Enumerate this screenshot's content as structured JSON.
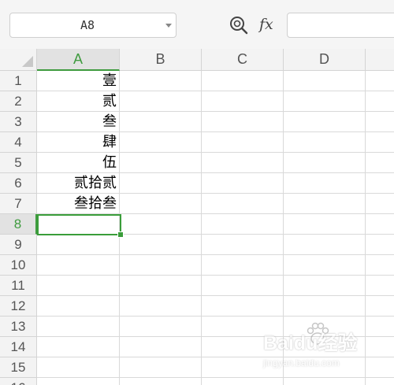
{
  "formula_bar": {
    "name_box_value": "A8",
    "zoom_icon": "zoom-lookup-icon",
    "fx_label": "fx",
    "formula_value": ""
  },
  "columns": [
    "A",
    "B",
    "C",
    "D"
  ],
  "active_column": "A",
  "rows": [
    "1",
    "2",
    "3",
    "4",
    "5",
    "6",
    "7",
    "8",
    "9",
    "10",
    "11",
    "12",
    "13",
    "14",
    "15",
    "16"
  ],
  "active_row": "8",
  "cells": {
    "A1": "壹",
    "A2": "贰",
    "A3": "叁",
    "A4": "肆",
    "A5": "伍",
    "A6": "贰拾贰",
    "A7": "叁拾叁"
  },
  "watermark": {
    "title": "Baidu经验",
    "url": "jingyan.baidu.com"
  },
  "colors": {
    "accent": "#3a9d3a",
    "header_bg": "#f3f3f3",
    "gridline": "#d9d9d9"
  }
}
